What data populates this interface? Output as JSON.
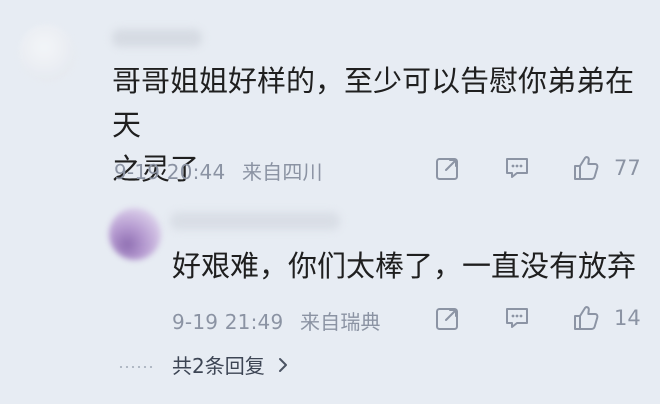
{
  "comments": {
    "main": {
      "text": "哥哥姐姐好样的，至少可以告慰你弟弟在天\n之灵了",
      "time": "9-19 20:44",
      "source": "来自四川",
      "like_count": "77"
    },
    "reply": {
      "text": "好艰难，你们太棒了，一直没有放弃",
      "time": "9-19 21:49",
      "source": "来自瑞典",
      "like_count": "14"
    },
    "summary": {
      "label": "共2条回复"
    }
  },
  "icons": {
    "share": "share-icon",
    "comment": "comment-icon",
    "like": "thumbs-up-icon",
    "chevron": "chevron-right-icon"
  },
  "colors": {
    "background": "#e7ecf3",
    "meta_text": "#8b93a3",
    "main_text": "#1f1f1f"
  }
}
